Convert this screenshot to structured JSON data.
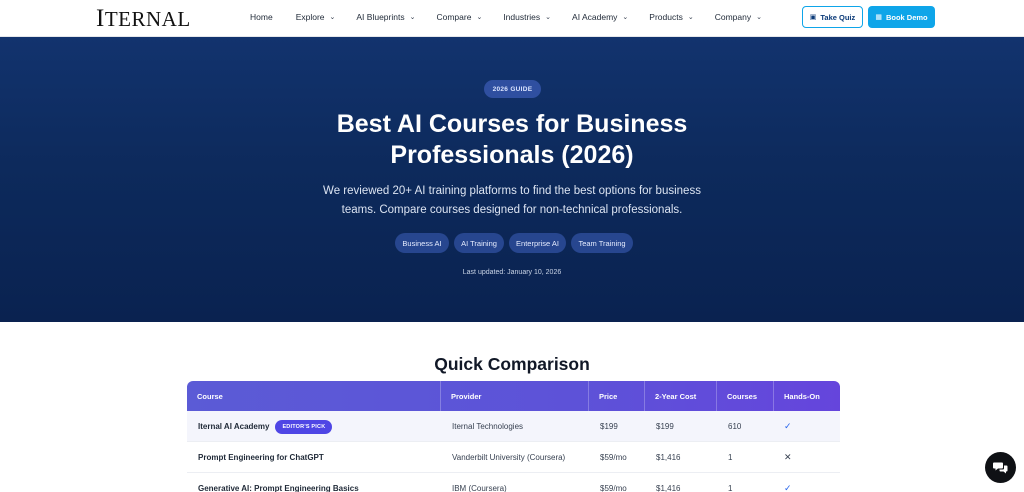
{
  "header": {
    "logo": "ITERNAL",
    "nav": [
      {
        "label": "Home",
        "dropdown": false
      },
      {
        "label": "Explore",
        "dropdown": true
      },
      {
        "label": "AI Blueprints",
        "dropdown": true
      },
      {
        "label": "Compare",
        "dropdown": true
      },
      {
        "label": "Industries",
        "dropdown": true
      },
      {
        "label": "AI Academy",
        "dropdown": true
      },
      {
        "label": "Products",
        "dropdown": true
      },
      {
        "label": "Company",
        "dropdown": true
      }
    ],
    "quiz_button": "Take Quiz",
    "demo_button": "Book Demo"
  },
  "hero": {
    "badge": "2026 GUIDE",
    "title": "Best AI Courses for Business Professionals (2026)",
    "subtitle": "We reviewed 20+ AI training platforms to find the best options for business teams. Compare courses designed for non-technical professionals.",
    "tags": [
      "Business AI",
      "AI Training",
      "Enterprise AI",
      "Team Training"
    ],
    "updated": "Last updated: January 10, 2026"
  },
  "comparison": {
    "title": "Quick Comparison",
    "headers": [
      "Course",
      "Provider",
      "Price",
      "2-Year Cost",
      "Courses",
      "Hands-On"
    ],
    "rows": [
      {
        "course": "Iternal AI Academy",
        "badge": "EDITOR'S PICK",
        "provider": "Iternal Technologies",
        "price": "$199",
        "cost": "$199",
        "courses": "610",
        "hands_on": "✓"
      },
      {
        "course": "Prompt Engineering for ChatGPT",
        "badge": "",
        "provider": "Vanderbilt University (Coursera)",
        "price": "$59/mo",
        "cost": "$1,416",
        "courses": "1",
        "hands_on": "✕"
      },
      {
        "course": "Generative AI: Prompt Engineering Basics",
        "badge": "",
        "provider": "IBM (Coursera)",
        "price": "$59/mo",
        "cost": "$1,416",
        "courses": "1",
        "hands_on": "✓"
      }
    ]
  },
  "colors": {
    "accent": "#0ea5e9",
    "hero_bg": "#0d2a5c",
    "table_header": "#5b5bd6",
    "badge_bg": "#4f46e5"
  }
}
